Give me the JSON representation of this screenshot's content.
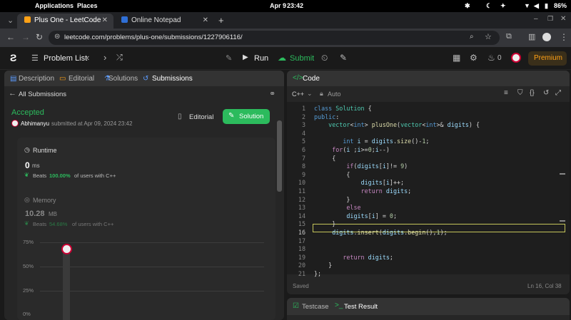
{
  "os": {
    "applications": "Applications",
    "places": "Places",
    "date": "Apr 9",
    "time": "23:42",
    "battery": "86%"
  },
  "browser": {
    "tabs": [
      {
        "title": "Plus One - LeetCode",
        "active": true
      },
      {
        "title": "Online Notepad",
        "active": false
      }
    ],
    "new_tab": "+",
    "url": "leetcode.com/problems/plus-one/submissions/1227906116/"
  },
  "header": {
    "problem_list": "Problem List",
    "run": "Run",
    "submit": "Submit",
    "streak": "0",
    "premium": "Premium"
  },
  "left": {
    "tabs": [
      "Description",
      "Editorial",
      "Solutions",
      "Submissions"
    ],
    "all_submissions": "All Submissions",
    "status": "Accepted",
    "user": "Abhimanyu",
    "submitted_text": "submitted at Apr 09, 2024 23:42",
    "editorial_btn": "Editorial",
    "solution_btn": "Solution",
    "runtime_label": "Runtime",
    "runtime_value": "0",
    "runtime_unit": "ms",
    "runtime_beats_prefix": "Beats",
    "runtime_beats_pct": "100.00%",
    "runtime_beats_suffix": "of users with C++",
    "memory_label": "Memory",
    "memory_value": "10.28",
    "memory_unit": "MB",
    "memory_beats_prefix": "Beats",
    "memory_beats_pct": "54.68%",
    "memory_beats_suffix": "of users with C++",
    "chart_ticks": [
      "75%",
      "50%",
      "25%",
      "0%"
    ]
  },
  "code": {
    "title": "Code",
    "language": "C++",
    "mode": "Auto",
    "saved": "Saved",
    "position": "Ln 16, Col 38",
    "lines": [
      "class Solution {",
      "public:",
      "    vector<int> plusOne(vector<int>& digits) {",
      "",
      "        int i = digits.size()-1;",
      "     for(i ;i>=0;i--)",
      "     {",
      "         if(digits[i]!= 9)",
      "         {",
      "             digits[i]++;",
      "             return digits;",
      "         }",
      "         else",
      "         digits[i] = 0;",
      "     }",
      "     digits.insert(digits.begin(),1);",
      "",
      "",
      "        return digits;",
      "    }",
      "};"
    ]
  },
  "bottom": {
    "testcase": "Testcase",
    "test_result": "Test Result"
  },
  "colors": {
    "accent_green": "#2cbb5d",
    "premium": "#ffa116",
    "background": "#1a1a1a",
    "panel": "#262626"
  }
}
